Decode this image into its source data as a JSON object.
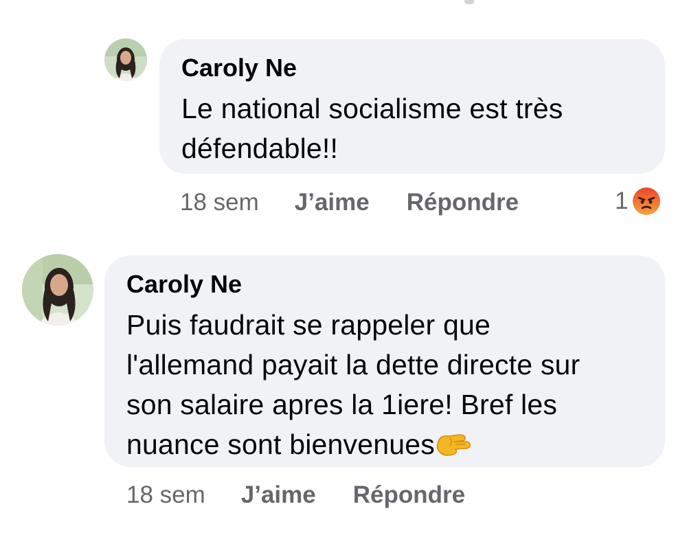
{
  "comments": [
    {
      "author": "Caroly Ne",
      "text_lines": [
        "Le national socialisme est très",
        "défendable!!"
      ],
      "time": "18 sem",
      "like_label": "J’aime",
      "reply_label": "Répondre",
      "reaction_count": "1",
      "reaction_icon": "angry-reaction-icon"
    },
    {
      "author": "Caroly Ne",
      "text_lines": [
        "Puis faudrait se rappeler que",
        "l'allemand payait la dette directe sur",
        "son salaire apres la 1iere! Bref les",
        "nuance sont bienvenues"
      ],
      "trailing_icon": "pinching-hand-icon",
      "time": "18 sem",
      "like_label": "J’aime",
      "reply_label": "Répondre"
    }
  ],
  "colors": {
    "bubble": "#f0f2f5",
    "text": "#050505",
    "meta": "#65676b",
    "angry": "#f26b3a"
  }
}
